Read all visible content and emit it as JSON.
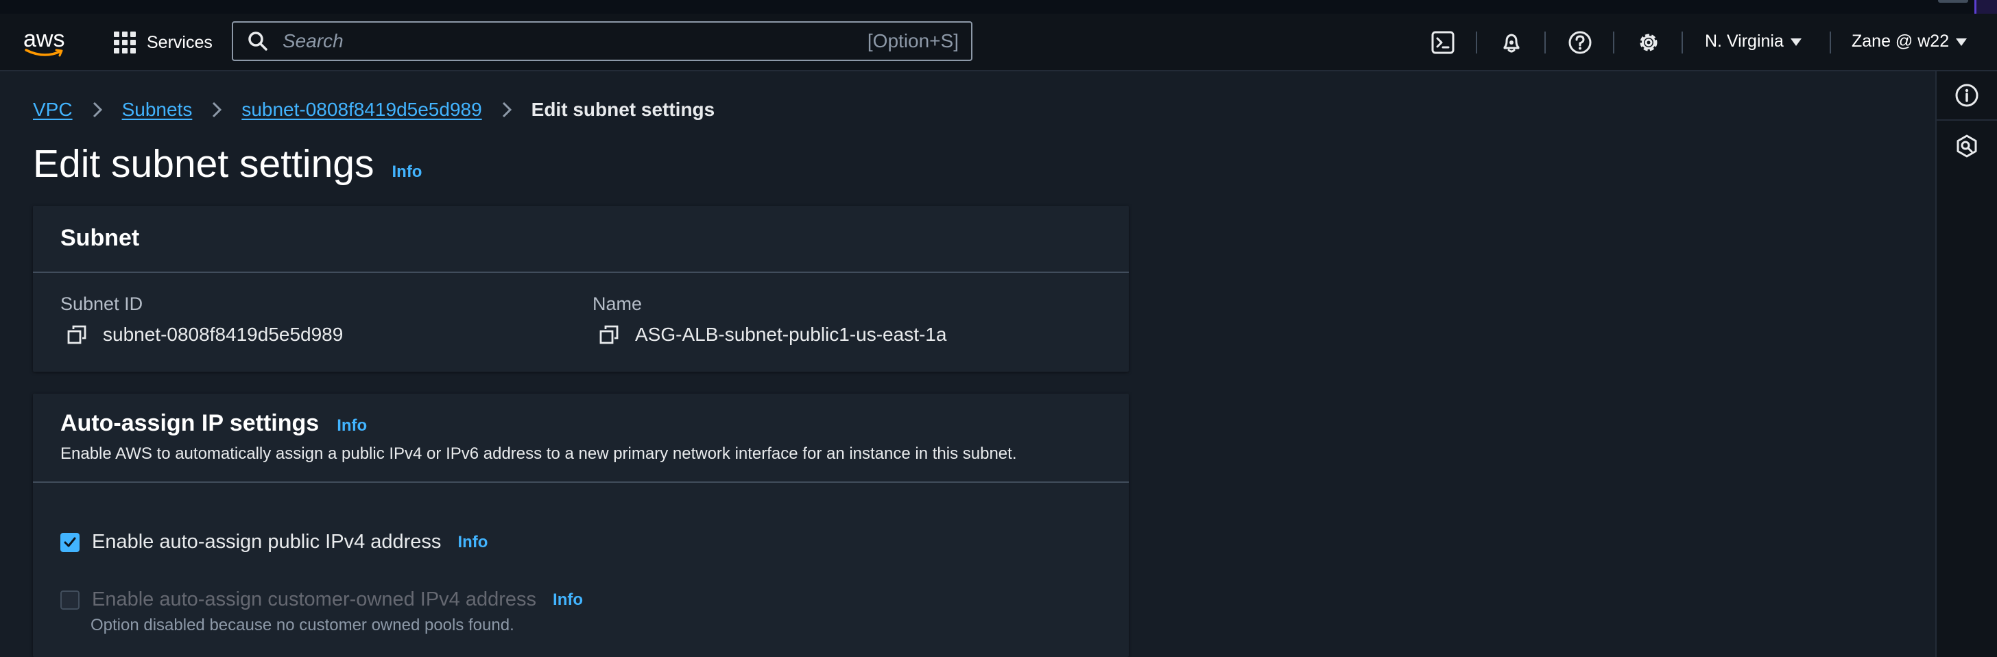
{
  "topbar": {
    "logo_text": "aws",
    "services_label": "Services",
    "search": {
      "placeholder": "Search",
      "shortcut": "[Option+S]"
    },
    "icons": [
      "cloudshell-icon",
      "bell-icon",
      "help-icon",
      "gear-icon"
    ],
    "region": "N. Virginia",
    "user": "Zane @ w22"
  },
  "breadcrumb": {
    "items": [
      "VPC",
      "Subnets",
      "subnet-0808f8419d5e5d989"
    ],
    "current": "Edit subnet settings"
  },
  "page": {
    "title": "Edit subnet settings",
    "info": "Info"
  },
  "subnet_panel": {
    "title": "Subnet",
    "subnet_id_label": "Subnet ID",
    "subnet_id": "subnet-0808f8419d5e5d989",
    "name_label": "Name",
    "name": "ASG-ALB-subnet-public1-us-east-1a"
  },
  "auto_assign_panel": {
    "title": "Auto-assign IP settings",
    "info": "Info",
    "description": "Enable AWS to automatically assign a public IPv4 or IPv6 address to a new primary network interface for an instance in this subnet.",
    "options": [
      {
        "label": "Enable auto-assign public IPv4 address",
        "info": "Info",
        "checked": true,
        "disabled": false
      },
      {
        "label": "Enable auto-assign customer-owned IPv4 address",
        "info": "Info",
        "checked": false,
        "disabled": true,
        "note": "Option disabled because no customer owned pools found."
      }
    ]
  },
  "colors": {
    "link": "#42b4ff",
    "background": "#161d26",
    "panel": "#1b232d",
    "navbar": "#0f141a"
  }
}
